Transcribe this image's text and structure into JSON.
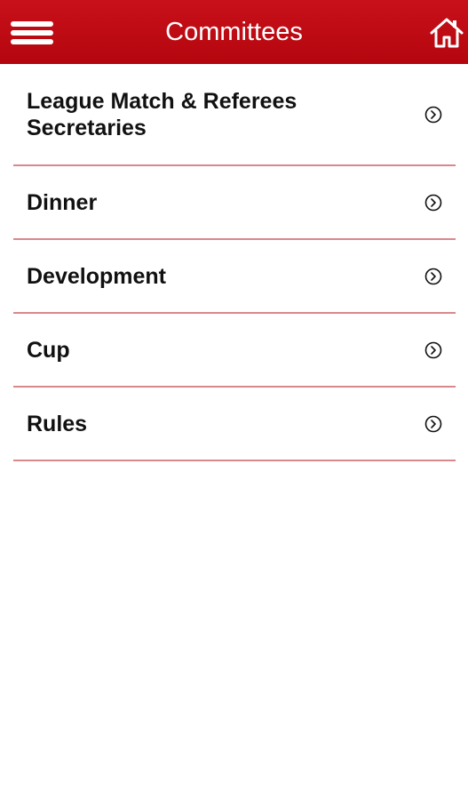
{
  "header": {
    "title": "Committees",
    "menu_icon": "hamburger-menu-icon",
    "home_icon": "home-icon",
    "color": "#bd0811"
  },
  "committees": [
    {
      "label": "League Match & Referees Secretaries"
    },
    {
      "label": "Dinner"
    },
    {
      "label": "Development"
    },
    {
      "label": "Cup"
    },
    {
      "label": "Rules"
    }
  ],
  "item_icon": "chevron-right-circle-icon",
  "divider_color": "#d9888c"
}
